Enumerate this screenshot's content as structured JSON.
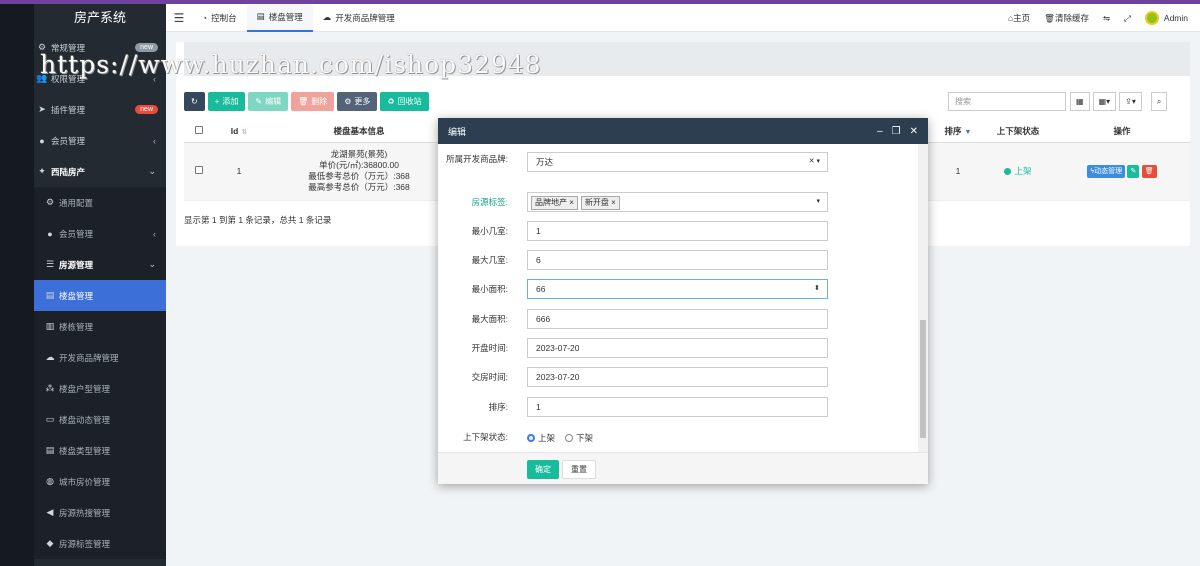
{
  "app": {
    "brand": "房产系统"
  },
  "watermark": "https://www.huzhan.com/ishop32948",
  "sidebar": {
    "items": [
      {
        "label": "常规管理",
        "icon": "gears-icon",
        "badge": "new"
      },
      {
        "label": "权限管理",
        "icon": "group-icon"
      },
      {
        "label": "插件管理",
        "icon": "rocket-icon",
        "badge": "new"
      },
      {
        "label": "会员管理",
        "icon": "user-circle-icon"
      },
      {
        "label": "西陆房产",
        "icon": "magic-icon"
      },
      {
        "label": "通用配置",
        "icon": "gear-icon"
      },
      {
        "label": "会员管理",
        "icon": "user-circle-icon"
      },
      {
        "label": "房源管理",
        "icon": "list-icon"
      },
      {
        "label": "楼盘管理",
        "icon": "book-icon"
      },
      {
        "label": "楼栋管理",
        "icon": "building-icon"
      },
      {
        "label": "开发商品牌管理",
        "icon": "cloud-icon"
      },
      {
        "label": "楼盘户型管理",
        "icon": "sitemap-icon"
      },
      {
        "label": "楼盘动态管理",
        "icon": "money-icon"
      },
      {
        "label": "楼盘类型管理",
        "icon": "book-icon"
      },
      {
        "label": "城市房价管理",
        "icon": "globe-icon"
      },
      {
        "label": "房源热搜管理",
        "icon": "bullhorn-icon"
      },
      {
        "label": "房源标签管理",
        "icon": "tags-icon"
      }
    ]
  },
  "navbar": {
    "tabs": [
      "控制台",
      "楼盘管理",
      "开发商品牌管理"
    ],
    "home": "主页",
    "clear_cache": "清除缓存",
    "user": "Admin"
  },
  "toolbar": {
    "add": "添加",
    "edit": "编辑",
    "delete": "删除",
    "more": "更多",
    "recycle": "回收站",
    "search_placeholder": "搜索"
  },
  "table": {
    "headers": [
      "Id",
      "楼盘基本信息",
      "排序",
      "上下架状态",
      "操作"
    ],
    "row": {
      "id": "1",
      "name": "龙湖景苑(景苑)",
      "price": "单价(元/㎡):36800.00",
      "min_total": "最低参考总价（万元）:368",
      "max_total": "最高参考总价（万元）:368",
      "sort": "1",
      "status": "上架",
      "op_dynamic": "动态管理"
    },
    "summary": "显示第 1 到第 1 条记录，总共 1 条记录"
  },
  "modal": {
    "title": "编辑",
    "fields": {
      "brand_label": "所属开发商品牌:",
      "brand_value": "万达",
      "tags_label": "房源标签:",
      "tags": [
        "品牌地产",
        "新开盘"
      ],
      "min_rooms_label": "最小几室:",
      "min_rooms": "1",
      "max_rooms_label": "最大几室:",
      "max_rooms": "6",
      "min_area_label": "最小面积:",
      "min_area": "66",
      "max_area_label": "最大面积:",
      "max_area": "666",
      "open_date_label": "开盘时间:",
      "open_date": "2023-07-20",
      "delivery_date_label": "交房时间:",
      "delivery_date": "2023-07-20",
      "sort_label": "排序:",
      "sort": "1",
      "status_label": "上下架状态:",
      "status_on": "上架",
      "status_off": "下架"
    },
    "confirm": "确定",
    "reset": "重置"
  }
}
